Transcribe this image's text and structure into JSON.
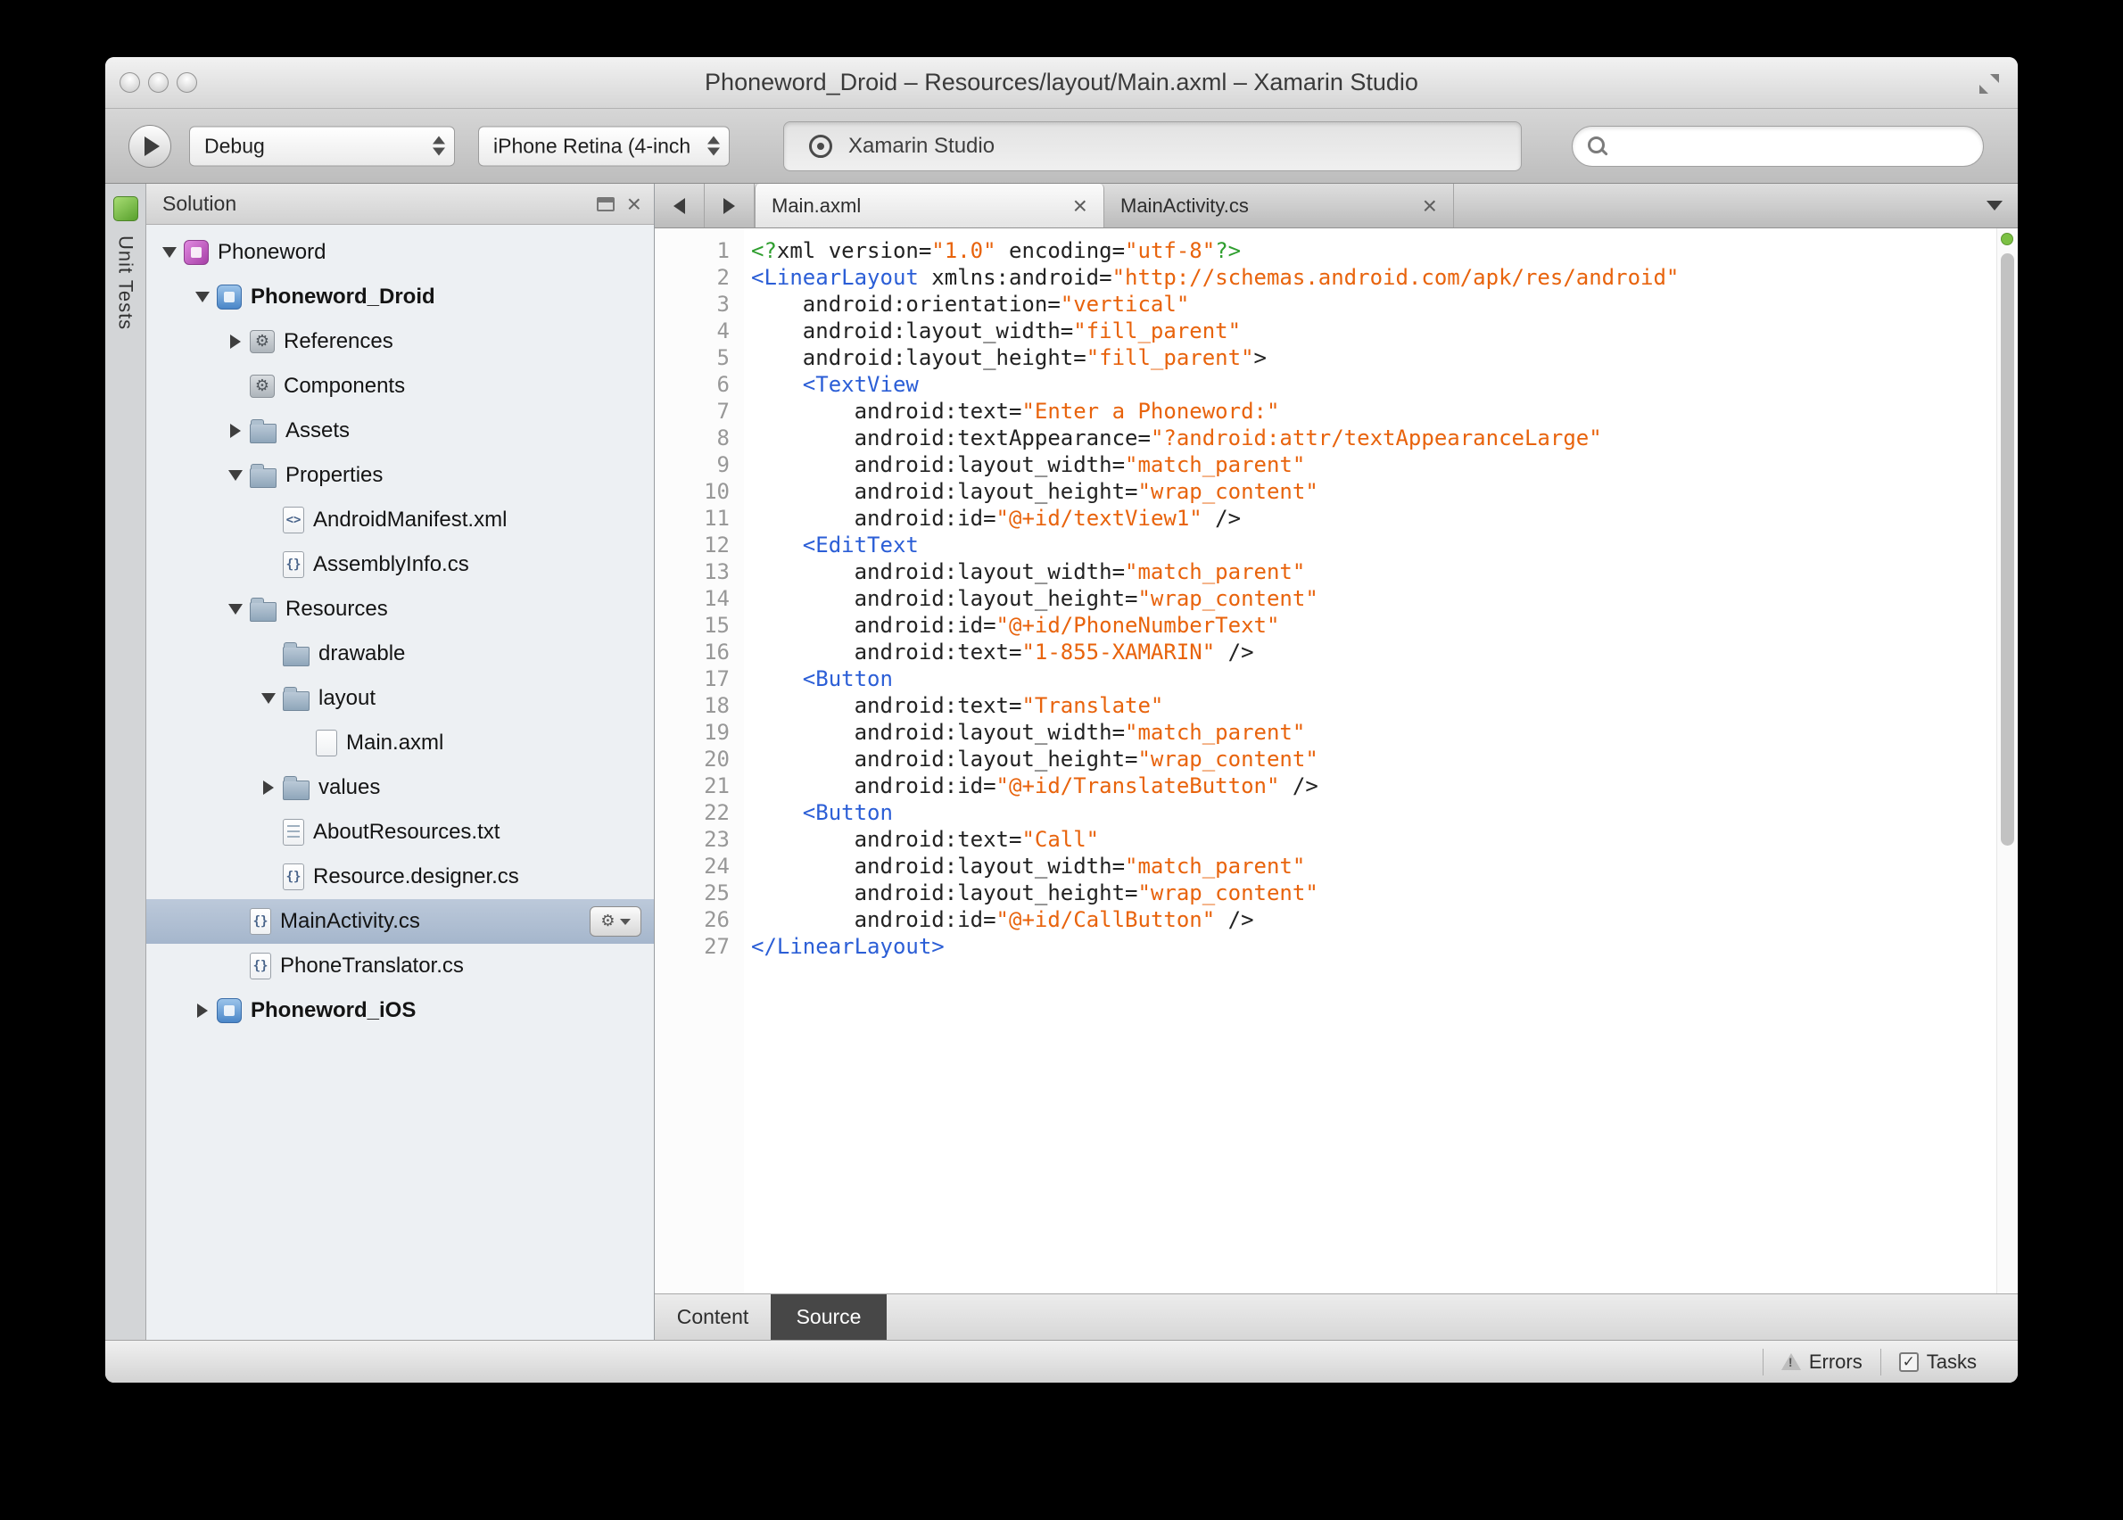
{
  "colors": {
    "syntax_tag": "#2b5ed6",
    "syntax_string": "#e8630c",
    "syntax_processing_instruction": "#2e9e2e",
    "syntax_plain": "#222222",
    "tree_selection": "#a5b6cc",
    "status_dot_green": "#7bc043"
  },
  "window": {
    "title": "Phoneword_Droid – Resources/layout/Main.axml – Xamarin Studio"
  },
  "toolbar": {
    "config_dropdown": "Debug",
    "device_dropdown": "iPhone Retina (4-inch",
    "status_text": "Xamarin Studio",
    "search_value": ""
  },
  "unit_tests": {
    "label": "Unit Tests"
  },
  "solution_pad": {
    "title": "Solution",
    "items": [
      {
        "label": "Phoneword",
        "level": 0,
        "icon": "solution",
        "expander": "open"
      },
      {
        "label": "Phoneword_Droid",
        "level": 1,
        "icon": "project-android",
        "expander": "open",
        "bold": true
      },
      {
        "label": "References",
        "level": 2,
        "icon": "references",
        "expander": "closed"
      },
      {
        "label": "Components",
        "level": 2,
        "icon": "components",
        "expander": "none"
      },
      {
        "label": "Assets",
        "level": 2,
        "icon": "folder",
        "expander": "closed"
      },
      {
        "label": "Properties",
        "level": 2,
        "icon": "folder",
        "expander": "open"
      },
      {
        "label": "AndroidManifest.xml",
        "level": 3,
        "icon": "file-xml",
        "expander": "none"
      },
      {
        "label": "AssemblyInfo.cs",
        "level": 3,
        "icon": "file-cs",
        "expander": "none"
      },
      {
        "label": "Resources",
        "level": 2,
        "icon": "folder",
        "expander": "open"
      },
      {
        "label": "drawable",
        "level": 3,
        "icon": "folder",
        "expander": "none"
      },
      {
        "label": "layout",
        "level": 3,
        "icon": "folder",
        "expander": "open"
      },
      {
        "label": "Main.axml",
        "level": 4,
        "icon": "file",
        "expander": "none"
      },
      {
        "label": "values",
        "level": 3,
        "icon": "folder",
        "expander": "closed"
      },
      {
        "label": "AboutResources.txt",
        "level": 3,
        "icon": "file-txt",
        "expander": "none"
      },
      {
        "label": "Resource.designer.cs",
        "level": 3,
        "icon": "file-cs",
        "expander": "none"
      },
      {
        "label": "MainActivity.cs",
        "level": 2,
        "icon": "file-cs",
        "expander": "none",
        "selected": true,
        "gear": true
      },
      {
        "label": "PhoneTranslator.cs",
        "level": 2,
        "icon": "file-cs",
        "expander": "none"
      },
      {
        "label": "Phoneword_iOS",
        "level": 1,
        "icon": "project-ios",
        "expander": "closed",
        "bold": true
      }
    ]
  },
  "editor": {
    "tabs": [
      {
        "label": "Main.axml",
        "active": true
      },
      {
        "label": "MainActivity.cs",
        "active": false
      }
    ],
    "footer_tabs": [
      {
        "label": "Content",
        "active": false
      },
      {
        "label": "Source",
        "active": true
      }
    ],
    "lines": [
      [
        [
          "pi",
          "<?"
        ],
        [
          "plain",
          "xml version="
        ],
        [
          "str",
          "\"1.0\""
        ],
        [
          "plain",
          " encoding="
        ],
        [
          "str",
          "\"utf-8\""
        ],
        [
          "pi",
          "?>"
        ]
      ],
      [
        [
          "tag",
          "<LinearLayout"
        ],
        [
          "plain",
          " xmlns:android="
        ],
        [
          "str",
          "\"http://schemas.android.com/apk/res/android\""
        ]
      ],
      [
        [
          "plain",
          "    android:orientation="
        ],
        [
          "str",
          "\"vertical\""
        ]
      ],
      [
        [
          "plain",
          "    android:layout_width="
        ],
        [
          "str",
          "\"fill_parent\""
        ]
      ],
      [
        [
          "plain",
          "    android:layout_height="
        ],
        [
          "str",
          "\"fill_parent\""
        ],
        [
          "plain",
          ">"
        ]
      ],
      [
        [
          "plain",
          "    "
        ],
        [
          "tag",
          "<TextView"
        ]
      ],
      [
        [
          "plain",
          "        android:text="
        ],
        [
          "str",
          "\"Enter a Phoneword:\""
        ]
      ],
      [
        [
          "plain",
          "        android:textAppearance="
        ],
        [
          "str",
          "\"?android:attr/textAppearanceLarge\""
        ]
      ],
      [
        [
          "plain",
          "        android:layout_width="
        ],
        [
          "str",
          "\"match_parent\""
        ]
      ],
      [
        [
          "plain",
          "        android:layout_height="
        ],
        [
          "str",
          "\"wrap_content\""
        ]
      ],
      [
        [
          "plain",
          "        android:id="
        ],
        [
          "str",
          "\"@+id/textView1\""
        ],
        [
          "plain",
          " />"
        ]
      ],
      [
        [
          "plain",
          "    "
        ],
        [
          "tag",
          "<EditText"
        ]
      ],
      [
        [
          "plain",
          "        android:layout_width="
        ],
        [
          "str",
          "\"match_parent\""
        ]
      ],
      [
        [
          "plain",
          "        android:layout_height="
        ],
        [
          "str",
          "\"wrap_content\""
        ]
      ],
      [
        [
          "plain",
          "        android:id="
        ],
        [
          "str",
          "\"@+id/PhoneNumberText\""
        ]
      ],
      [
        [
          "plain",
          "        android:text="
        ],
        [
          "str",
          "\"1-855-XAMARIN\""
        ],
        [
          "plain",
          " />"
        ]
      ],
      [
        [
          "plain",
          "    "
        ],
        [
          "tag",
          "<Button"
        ]
      ],
      [
        [
          "plain",
          "        android:text="
        ],
        [
          "str",
          "\"Translate\""
        ]
      ],
      [
        [
          "plain",
          "        android:layout_width="
        ],
        [
          "str",
          "\"match_parent\""
        ]
      ],
      [
        [
          "plain",
          "        android:layout_height="
        ],
        [
          "str",
          "\"wrap_content\""
        ]
      ],
      [
        [
          "plain",
          "        android:id="
        ],
        [
          "str",
          "\"@+id/TranslateButton\""
        ],
        [
          "plain",
          " />"
        ]
      ],
      [
        [
          "plain",
          "    "
        ],
        [
          "tag",
          "<Button"
        ]
      ],
      [
        [
          "plain",
          "        android:text="
        ],
        [
          "str",
          "\"Call\""
        ]
      ],
      [
        [
          "plain",
          "        android:layout_width="
        ],
        [
          "str",
          "\"match_parent\""
        ]
      ],
      [
        [
          "plain",
          "        android:layout_height="
        ],
        [
          "str",
          "\"wrap_content\""
        ]
      ],
      [
        [
          "plain",
          "        android:id="
        ],
        [
          "str",
          "\"@+id/CallButton\""
        ],
        [
          "plain",
          " />"
        ]
      ],
      [
        [
          "tag",
          "</LinearLayout>"
        ]
      ]
    ]
  },
  "statusbar": {
    "errors_label": "Errors",
    "tasks_label": "Tasks"
  }
}
